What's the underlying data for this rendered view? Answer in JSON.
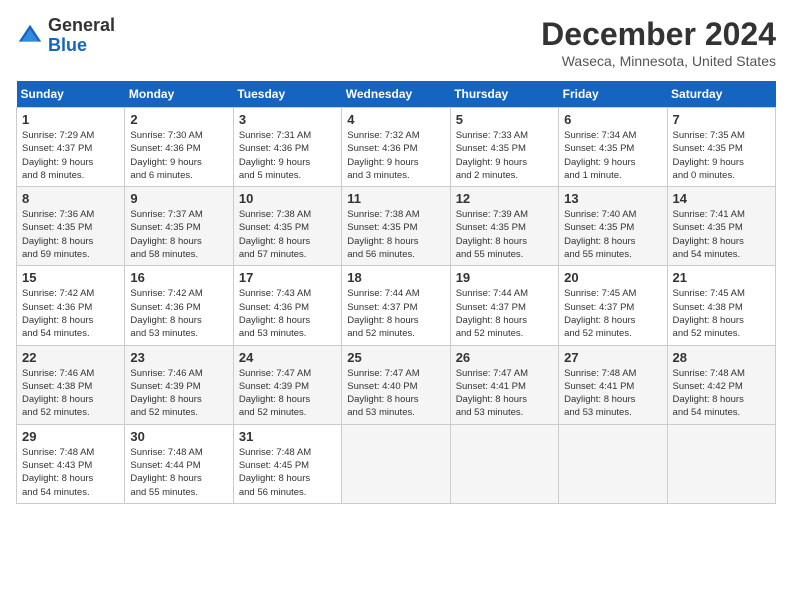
{
  "header": {
    "logo_general": "General",
    "logo_blue": "Blue",
    "month_title": "December 2024",
    "location": "Waseca, Minnesota, United States"
  },
  "days_of_week": [
    "Sunday",
    "Monday",
    "Tuesday",
    "Wednesday",
    "Thursday",
    "Friday",
    "Saturday"
  ],
  "weeks": [
    [
      {
        "day": 1,
        "info": "Sunrise: 7:29 AM\nSunset: 4:37 PM\nDaylight: 9 hours\nand 8 minutes."
      },
      {
        "day": 2,
        "info": "Sunrise: 7:30 AM\nSunset: 4:36 PM\nDaylight: 9 hours\nand 6 minutes."
      },
      {
        "day": 3,
        "info": "Sunrise: 7:31 AM\nSunset: 4:36 PM\nDaylight: 9 hours\nand 5 minutes."
      },
      {
        "day": 4,
        "info": "Sunrise: 7:32 AM\nSunset: 4:36 PM\nDaylight: 9 hours\nand 3 minutes."
      },
      {
        "day": 5,
        "info": "Sunrise: 7:33 AM\nSunset: 4:35 PM\nDaylight: 9 hours\nand 2 minutes."
      },
      {
        "day": 6,
        "info": "Sunrise: 7:34 AM\nSunset: 4:35 PM\nDaylight: 9 hours\nand 1 minute."
      },
      {
        "day": 7,
        "info": "Sunrise: 7:35 AM\nSunset: 4:35 PM\nDaylight: 9 hours\nand 0 minutes."
      }
    ],
    [
      {
        "day": 8,
        "info": "Sunrise: 7:36 AM\nSunset: 4:35 PM\nDaylight: 8 hours\nand 59 minutes."
      },
      {
        "day": 9,
        "info": "Sunrise: 7:37 AM\nSunset: 4:35 PM\nDaylight: 8 hours\nand 58 minutes."
      },
      {
        "day": 10,
        "info": "Sunrise: 7:38 AM\nSunset: 4:35 PM\nDaylight: 8 hours\nand 57 minutes."
      },
      {
        "day": 11,
        "info": "Sunrise: 7:38 AM\nSunset: 4:35 PM\nDaylight: 8 hours\nand 56 minutes."
      },
      {
        "day": 12,
        "info": "Sunrise: 7:39 AM\nSunset: 4:35 PM\nDaylight: 8 hours\nand 55 minutes."
      },
      {
        "day": 13,
        "info": "Sunrise: 7:40 AM\nSunset: 4:35 PM\nDaylight: 8 hours\nand 55 minutes."
      },
      {
        "day": 14,
        "info": "Sunrise: 7:41 AM\nSunset: 4:35 PM\nDaylight: 8 hours\nand 54 minutes."
      }
    ],
    [
      {
        "day": 15,
        "info": "Sunrise: 7:42 AM\nSunset: 4:36 PM\nDaylight: 8 hours\nand 54 minutes."
      },
      {
        "day": 16,
        "info": "Sunrise: 7:42 AM\nSunset: 4:36 PM\nDaylight: 8 hours\nand 53 minutes."
      },
      {
        "day": 17,
        "info": "Sunrise: 7:43 AM\nSunset: 4:36 PM\nDaylight: 8 hours\nand 53 minutes."
      },
      {
        "day": 18,
        "info": "Sunrise: 7:44 AM\nSunset: 4:37 PM\nDaylight: 8 hours\nand 52 minutes."
      },
      {
        "day": 19,
        "info": "Sunrise: 7:44 AM\nSunset: 4:37 PM\nDaylight: 8 hours\nand 52 minutes."
      },
      {
        "day": 20,
        "info": "Sunrise: 7:45 AM\nSunset: 4:37 PM\nDaylight: 8 hours\nand 52 minutes."
      },
      {
        "day": 21,
        "info": "Sunrise: 7:45 AM\nSunset: 4:38 PM\nDaylight: 8 hours\nand 52 minutes."
      }
    ],
    [
      {
        "day": 22,
        "info": "Sunrise: 7:46 AM\nSunset: 4:38 PM\nDaylight: 8 hours\nand 52 minutes."
      },
      {
        "day": 23,
        "info": "Sunrise: 7:46 AM\nSunset: 4:39 PM\nDaylight: 8 hours\nand 52 minutes."
      },
      {
        "day": 24,
        "info": "Sunrise: 7:47 AM\nSunset: 4:39 PM\nDaylight: 8 hours\nand 52 minutes."
      },
      {
        "day": 25,
        "info": "Sunrise: 7:47 AM\nSunset: 4:40 PM\nDaylight: 8 hours\nand 53 minutes."
      },
      {
        "day": 26,
        "info": "Sunrise: 7:47 AM\nSunset: 4:41 PM\nDaylight: 8 hours\nand 53 minutes."
      },
      {
        "day": 27,
        "info": "Sunrise: 7:48 AM\nSunset: 4:41 PM\nDaylight: 8 hours\nand 53 minutes."
      },
      {
        "day": 28,
        "info": "Sunrise: 7:48 AM\nSunset: 4:42 PM\nDaylight: 8 hours\nand 54 minutes."
      }
    ],
    [
      {
        "day": 29,
        "info": "Sunrise: 7:48 AM\nSunset: 4:43 PM\nDaylight: 8 hours\nand 54 minutes."
      },
      {
        "day": 30,
        "info": "Sunrise: 7:48 AM\nSunset: 4:44 PM\nDaylight: 8 hours\nand 55 minutes."
      },
      {
        "day": 31,
        "info": "Sunrise: 7:48 AM\nSunset: 4:45 PM\nDaylight: 8 hours\nand 56 minutes."
      },
      null,
      null,
      null,
      null
    ]
  ]
}
